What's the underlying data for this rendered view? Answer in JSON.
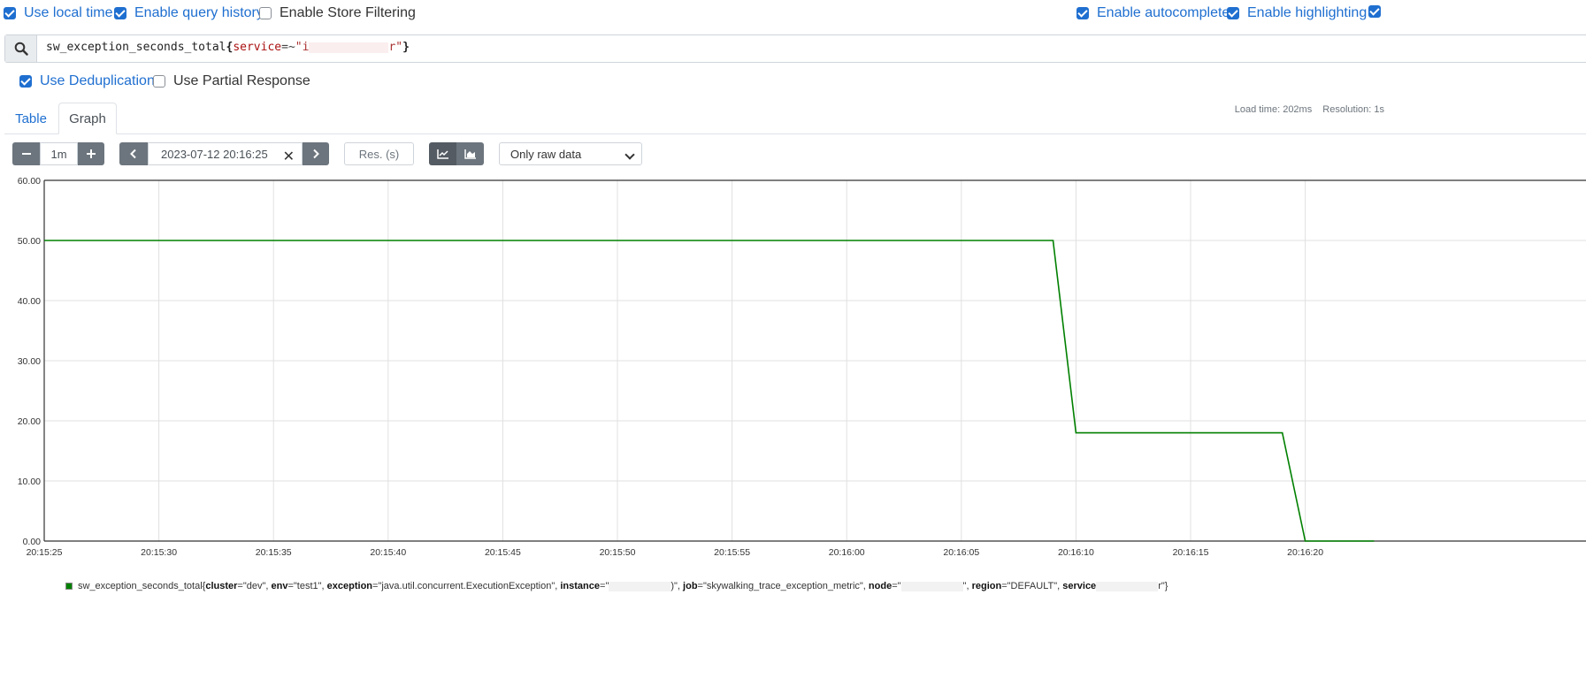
{
  "options": {
    "use_local_time": {
      "label": "Use local time",
      "checked": true
    },
    "enable_query_history": {
      "label": "Enable query history",
      "checked": true
    },
    "enable_store_filtering": {
      "label": "Enable Store Filtering",
      "checked": false
    },
    "enable_autocomplete": {
      "label": "Enable autocomplete",
      "checked": true
    },
    "enable_highlighting": {
      "label": "Enable highlighting",
      "checked": true
    }
  },
  "query": {
    "metric": "sw_exception_seconds_total",
    "open_brace": "{",
    "label": "service",
    "operator": "=~",
    "value_start": "\"i",
    "value_end": "r\"",
    "close_brace": "}"
  },
  "dedup": {
    "label": "Use Deduplication",
    "checked": true
  },
  "partial": {
    "label": "Use Partial Response",
    "checked": false
  },
  "tabs": [
    {
      "label": "Table"
    },
    {
      "label": "Graph"
    }
  ],
  "stats": {
    "load_time": "Load time: 202ms",
    "resolution": "Resolution: 1s"
  },
  "controls": {
    "range": "1m",
    "end_time": "2023-07-12 20:16:25",
    "res_placeholder": "Res. (s)",
    "mode": "Only raw data"
  },
  "chart_data": {
    "type": "line",
    "x_ticks": [
      "20:15:25",
      "20:15:30",
      "20:15:35",
      "20:15:40",
      "20:15:45",
      "20:15:50",
      "20:15:55",
      "20:16:00",
      "20:16:05",
      "20:16:10",
      "20:16:15",
      "20:16:20"
    ],
    "y_ticks": [
      "0.00",
      "10.00",
      "20.00",
      "30.00",
      "40.00",
      "50.00",
      "60.00"
    ],
    "ylim": [
      0,
      60
    ],
    "grid": true,
    "line_color": "#008000",
    "series": [
      {
        "points": [
          {
            "t": "20:15:25",
            "y": 50
          },
          {
            "t": "20:16:09",
            "y": 50
          },
          {
            "t": "20:16:10",
            "y": 18
          },
          {
            "t": "20:16:19",
            "y": 18
          },
          {
            "t": "20:16:20",
            "y": 0
          },
          {
            "t": "20:16:23",
            "y": 0
          }
        ]
      }
    ]
  },
  "legend": {
    "metric": "sw_exception_seconds_total{",
    "k_cluster": "cluster",
    "v_cluster": "=\"dev\", ",
    "k_env": "env",
    "v_env": "=\"test1\", ",
    "k_exception": "exception",
    "v_exception": "=\"java.util.concurrent.ExecutionException\", ",
    "k_instance": "instance",
    "v_instance_start": "=\"",
    "v_instance_end": ")\", ",
    "k_job": "job",
    "v_job": "=\"skywalking_trace_exception_metric\", ",
    "k_node": "node",
    "v_node_start": "=\"",
    "v_node_end": "\", ",
    "k_region": "region",
    "v_region": "=\"DEFAULT\", ",
    "k_service": "service",
    "v_service_end": "r\"}"
  }
}
